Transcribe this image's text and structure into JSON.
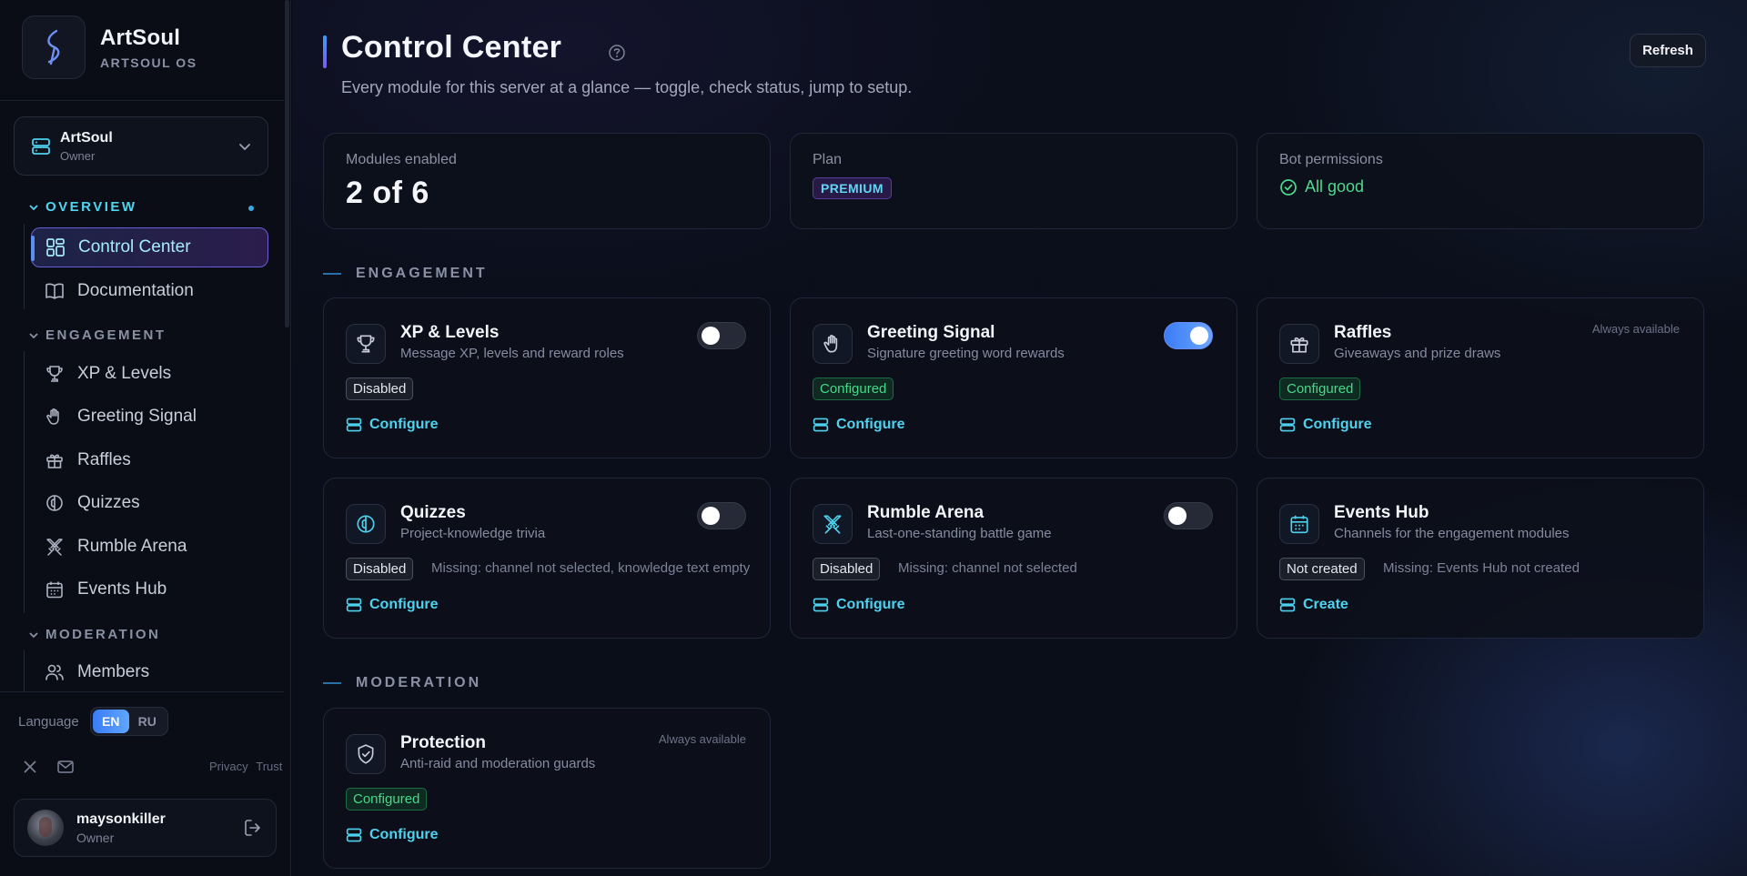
{
  "brand": {
    "name": "ArtSoul",
    "subtitle": "ARTSOUL OS"
  },
  "server": {
    "name": "ArtSoul",
    "role": "Owner"
  },
  "sidebar": {
    "sections": [
      {
        "label": "OVERVIEW"
      },
      {
        "label": "ENGAGEMENT"
      },
      {
        "label": "MODERATION"
      }
    ],
    "items": [
      {
        "label": "Control Center"
      },
      {
        "label": "Documentation"
      },
      {
        "label": "XP & Levels"
      },
      {
        "label": "Greeting Signal"
      },
      {
        "label": "Raffles"
      },
      {
        "label": "Quizzes"
      },
      {
        "label": "Rumble Arena"
      },
      {
        "label": "Events Hub"
      },
      {
        "label": "Members"
      }
    ]
  },
  "language": {
    "label": "Language",
    "options": [
      "EN",
      "RU"
    ],
    "selected": "EN"
  },
  "footer_links": {
    "privacy": "Privacy",
    "trust": "Trust"
  },
  "user": {
    "name": "maysonkiller",
    "role": "Owner"
  },
  "page": {
    "title": "Control Center",
    "subtitle": "Every module for this server at a glance — toggle, check status, jump to setup.",
    "refresh_label": "Refresh"
  },
  "stats": {
    "modules": {
      "label": "Modules enabled",
      "value": "2 of 6"
    },
    "plan": {
      "label": "Plan",
      "value": "PREMIUM"
    },
    "permissions": {
      "label": "Bot permissions",
      "value": "All good"
    }
  },
  "groups": {
    "engagement": "ENGAGEMENT",
    "moderation": "MODERATION"
  },
  "cards": [
    {
      "title": "XP & Levels",
      "desc": "Message XP, levels and reward roles",
      "status": "Disabled",
      "toggle_on": false,
      "missing": "",
      "action": "Configure"
    },
    {
      "title": "Greeting Signal",
      "desc": "Signature greeting word rewards",
      "status": "Configured",
      "toggle_on": true,
      "missing": "",
      "action": "Configure"
    },
    {
      "title": "Raffles",
      "desc": "Giveaways and prize draws",
      "status": "Configured",
      "note": "Always available",
      "missing": "",
      "action": "Configure"
    },
    {
      "title": "Quizzes",
      "desc": "Project-knowledge trivia",
      "status": "Disabled",
      "toggle_on": false,
      "missing": "Missing: channel not selected, knowledge text empty",
      "action": "Configure"
    },
    {
      "title": "Rumble Arena",
      "desc": "Last-one-standing battle game",
      "status": "Disabled",
      "toggle_on": false,
      "missing": "Missing: channel not selected",
      "action": "Configure"
    },
    {
      "title": "Events Hub",
      "desc": "Channels for the engagement modules",
      "status": "Not created",
      "missing": "Missing: Events Hub not created",
      "action": "Create"
    },
    {
      "title": "Protection",
      "desc": "Anti-raid and moderation guards",
      "status": "Configured",
      "note": "Always available",
      "missing": "",
      "action": "Configure"
    }
  ],
  "colors": {
    "accent": "#4ed2ee",
    "success": "#47d98b",
    "toggle_on": "#3b7cf5",
    "background": "#0a0e18"
  }
}
